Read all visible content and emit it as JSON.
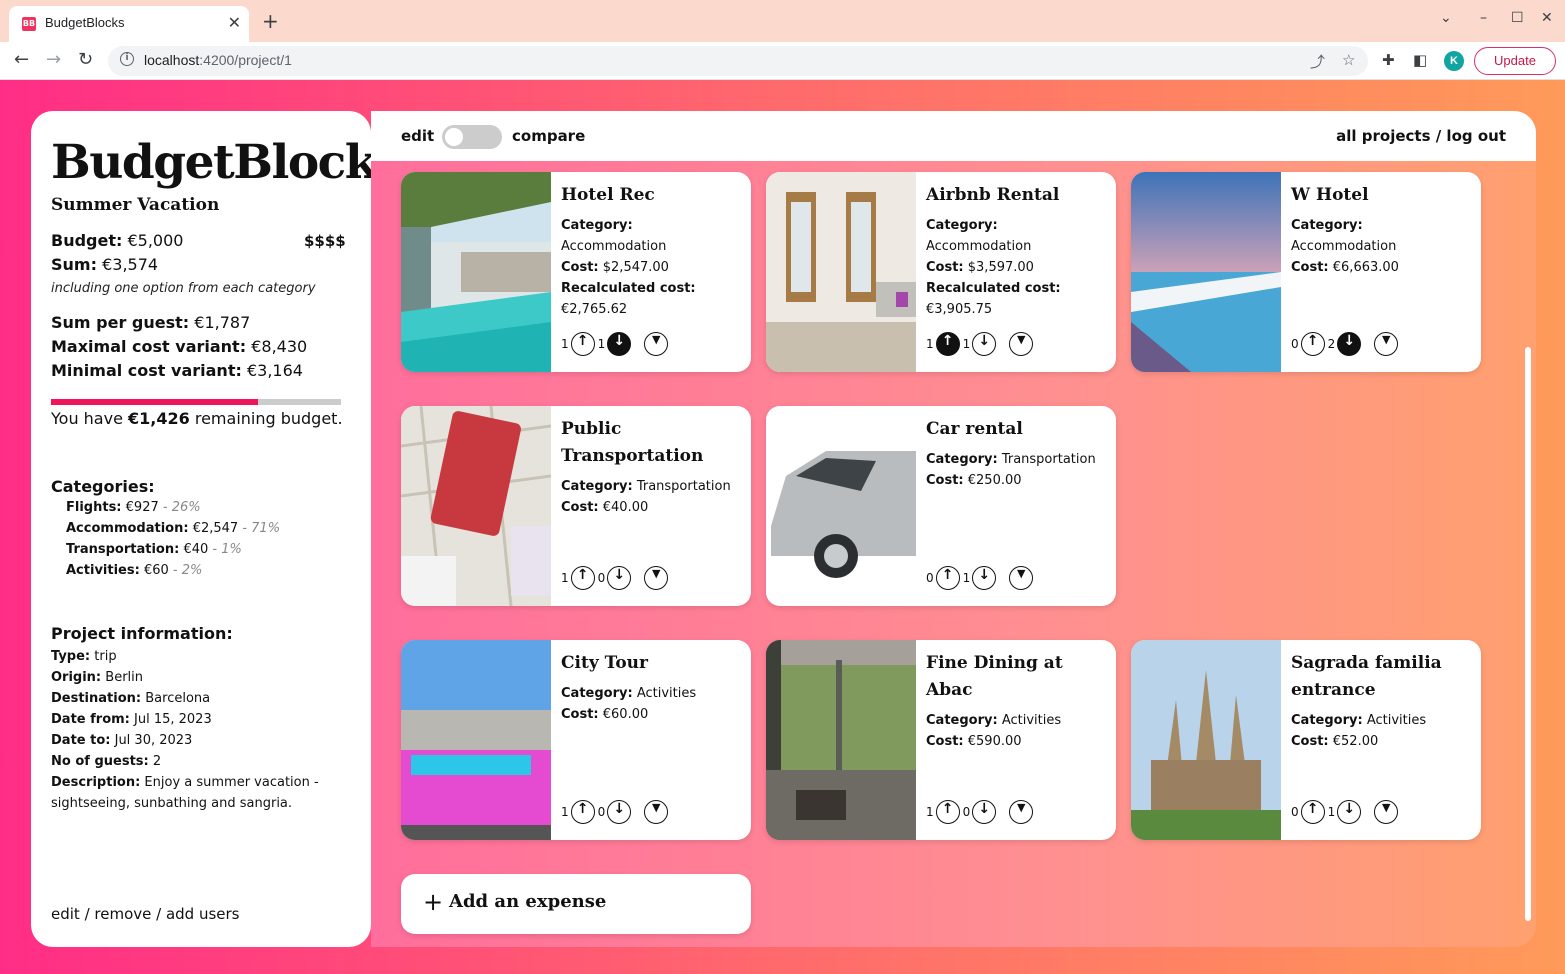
{
  "browser": {
    "tab_title": "BudgetBlocks",
    "tab_favicon": "BB",
    "url_host": "localhost",
    "url_path": ":4200/project/1",
    "avatar_letter": "K",
    "update_label": "Update"
  },
  "sidebar": {
    "brand": "BudgetBlocks",
    "project_name": "Summer Vacation",
    "budget_label": "Budget:",
    "budget_value": "€5,000",
    "price_level": "$$$$",
    "sum_label": "Sum:",
    "sum_value": "€3,574",
    "sum_note": "including one option from each category",
    "per_guest_label": "Sum per guest:",
    "per_guest_value": "€1,787",
    "max_label": "Maximal cost variant:",
    "max_value": "€8,430",
    "min_label": "Minimal cost variant:",
    "min_value": "€3,164",
    "budget_used_fraction": 0.715,
    "remaining_pre": "You have ",
    "remaining_amount": "€1,426",
    "remaining_post": " remaining budget.",
    "categories_heading": "Categories:",
    "categories": [
      {
        "name": "Flights:",
        "amount": "€927",
        "pct": " - 26%"
      },
      {
        "name": "Accommodation:",
        "amount": "€2,547",
        "pct": " - 71%"
      },
      {
        "name": "Transportation:",
        "amount": "€40",
        "pct": " - 1%"
      },
      {
        "name": "Activities:",
        "amount": "€60",
        "pct": " - 2%"
      }
    ],
    "info_heading": "Project information:",
    "info": [
      {
        "label": "Type:",
        "value": "trip"
      },
      {
        "label": "Origin:",
        "value": "Berlin"
      },
      {
        "label": "Destination:",
        "value": "Barcelona"
      },
      {
        "label": "Date from:",
        "value": "Jul 15, 2023"
      },
      {
        "label": "Date to:",
        "value": "Jul 30, 2023"
      },
      {
        "label": "No of guests:",
        "value": "2"
      },
      {
        "label": "Description:",
        "value": "Enjoy a summer vacation - sightseeing, sunbathing and sangria."
      }
    ],
    "footer": "edit / remove / add users"
  },
  "topbar": {
    "edit_label": "edit",
    "compare_label": "compare",
    "links": "all projects / log out"
  },
  "labels": {
    "category": "Category:",
    "cost": "Cost:",
    "recalc": "Recalculated cost:"
  },
  "cards": [
    {
      "title": "Hotel Rec",
      "category": "Accommodation",
      "cost": "$2,547.00",
      "recalc": "€2,765.62",
      "up": "1",
      "down": "1",
      "up_on": false,
      "down_on": true
    },
    {
      "title": "Airbnb Rental",
      "category": "Accommodation",
      "cost": "$3,597.00",
      "recalc": "€3,905.75",
      "up": "1",
      "down": "1",
      "up_on": true,
      "down_on": false
    },
    {
      "title": "W Hotel",
      "category": "Accommodation",
      "cost": "€6,663.00",
      "up": "0",
      "down": "2",
      "up_on": false,
      "down_on": true
    },
    {
      "title": "Public Transportation",
      "category": "Transportation",
      "cost": "€40.00",
      "up": "1",
      "down": "0",
      "up_on": false,
      "down_on": false
    },
    {
      "title": "Car rental",
      "category": "Transportation",
      "cost": "€250.00",
      "up": "0",
      "down": "1",
      "up_on": false,
      "down_on": false
    },
    {
      "title": "City Tour",
      "category": "Activities",
      "cost": "€60.00",
      "up": "1",
      "down": "0",
      "up_on": false,
      "down_on": false
    },
    {
      "title": "Fine Dining at Abac",
      "category": "Activities",
      "cost": "€590.00",
      "up": "1",
      "down": "0",
      "up_on": false,
      "down_on": false
    },
    {
      "title": "Sagrada familia entrance",
      "category": "Activities",
      "cost": "€52.00",
      "up": "0",
      "down": "1",
      "up_on": false,
      "down_on": false
    }
  ],
  "add_expense_label": "Add an expense"
}
